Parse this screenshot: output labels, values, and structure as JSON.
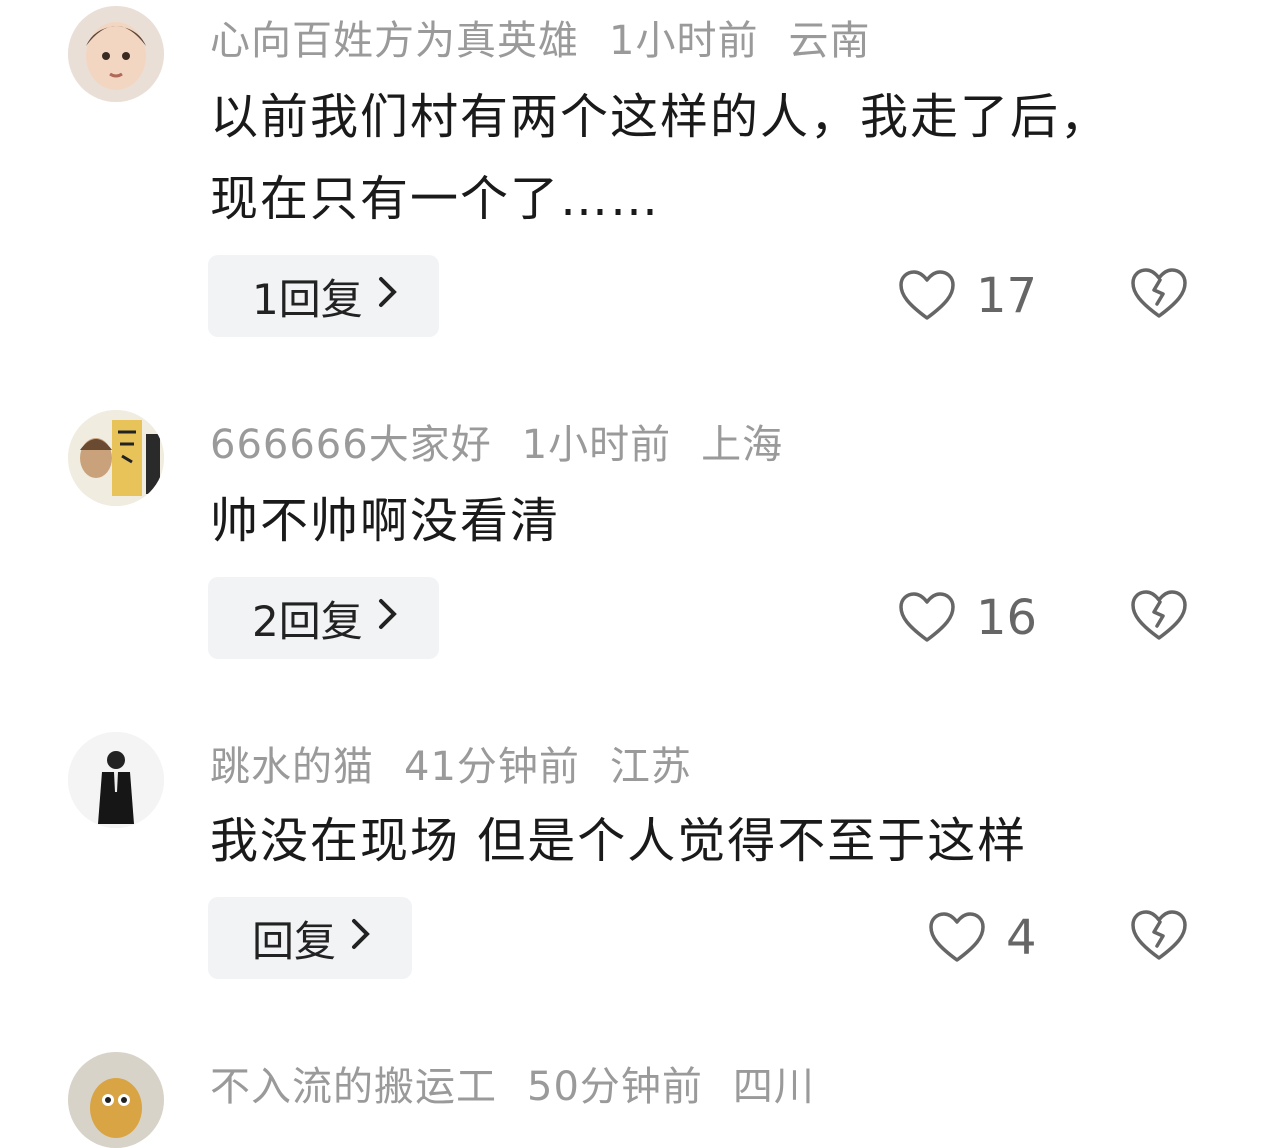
{
  "comments": [
    {
      "user": "心向百姓方为真英雄",
      "time": "1小时前",
      "location": "云南",
      "text_line1": "以前我们村有两个这样的人，我走了后，",
      "text_line2": "现在只有一个了……",
      "reply_label": "1回复",
      "likes": "17",
      "avatar": "baby-avatar"
    },
    {
      "user": "666666大家好",
      "time": "1小时前",
      "location": "上海",
      "text_line1": "帅不帅啊没看清",
      "reply_label": "2回复",
      "likes": "16",
      "avatar": "anime-avatar"
    },
    {
      "user": "跳水的猫",
      "time": "41分钟前",
      "location": "江苏",
      "text_line1": "我没在现场 但是个人觉得不至于这样",
      "reply_label": "回复",
      "likes": "4",
      "avatar": "suit-figure-avatar"
    },
    {
      "user": "不入流的搬运工",
      "time": "50分钟前",
      "location": "四川",
      "avatar": "cartoon-avatar"
    }
  ]
}
